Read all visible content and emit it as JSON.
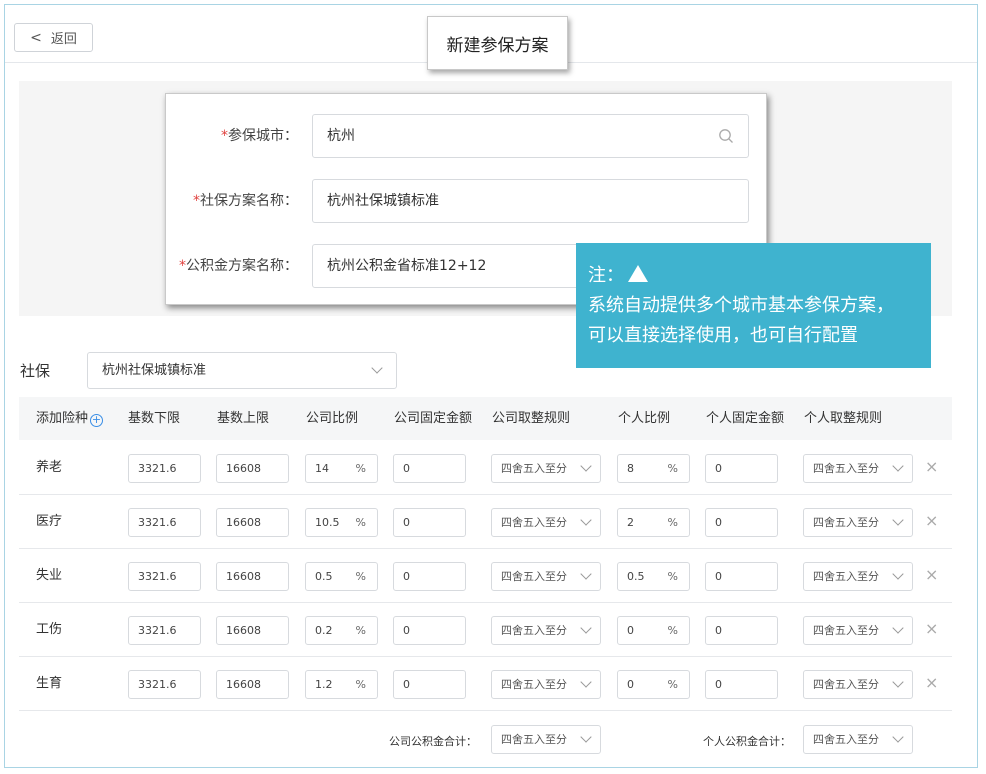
{
  "header": {
    "back_label": "返回",
    "title": "新建参保方案"
  },
  "form": {
    "city": {
      "label": "参保城市：",
      "value": "杭州",
      "required": "*"
    },
    "social_plan": {
      "label": "社保方案名称：",
      "value": "杭州社保城镇标准",
      "required": "*"
    },
    "fund_plan": {
      "label": "公积金方案名称：",
      "value": "杭州公积金省标准12+12",
      "required": "*"
    }
  },
  "note": {
    "line1": "注：",
    "line2": "系统自动提供多个城市基本参保方案，",
    "line3": "可以直接选择使用，也可自行配置"
  },
  "social": {
    "label": "社保",
    "selected": "杭州社保城镇标准"
  },
  "table": {
    "headers": [
      "添加险种",
      "基数下限",
      "基数上限",
      "公司比例",
      "公司固定金额",
      "公司取整规则",
      "个人比例",
      "个人固定金额",
      "个人取整规则"
    ],
    "percent_unit": "%",
    "rows": [
      {
        "name": "养老",
        "base_min": "3321.6",
        "base_max": "16608",
        "company_ratio": "14",
        "company_fixed": "0",
        "company_round": "四舍五入至分",
        "personal_ratio": "8",
        "personal_fixed": "0",
        "personal_round": "四舍五入至分"
      },
      {
        "name": "医疗",
        "base_min": "3321.6",
        "base_max": "16608",
        "company_ratio": "10.5",
        "company_fixed": "0",
        "company_round": "四舍五入至分",
        "personal_ratio": "2",
        "personal_fixed": "0",
        "personal_round": "四舍五入至分"
      },
      {
        "name": "失业",
        "base_min": "3321.6",
        "base_max": "16608",
        "company_ratio": "0.5",
        "company_fixed": "0",
        "company_round": "四舍五入至分",
        "personal_ratio": "0.5",
        "personal_fixed": "0",
        "personal_round": "四舍五入至分"
      },
      {
        "name": "工伤",
        "base_min": "3321.6",
        "base_max": "16608",
        "company_ratio": "0.2",
        "company_fixed": "0",
        "company_round": "四舍五入至分",
        "personal_ratio": "0",
        "personal_fixed": "0",
        "personal_round": "四舍五入至分"
      },
      {
        "name": "生育",
        "base_min": "3321.6",
        "base_max": "16608",
        "company_ratio": "1.2",
        "company_fixed": "0",
        "company_round": "四舍五入至分",
        "personal_ratio": "0",
        "personal_fixed": "0",
        "personal_round": "四舍五入至分"
      }
    ]
  },
  "footer": {
    "company_total_label": "公司公积金合计：",
    "company_total_round": "四舍五入至分",
    "personal_total_label": "个人公积金合计：",
    "personal_total_round": "四舍五入至分"
  },
  "icons": {
    "back": "chevron-left-icon",
    "search": "search-icon",
    "add": "plus-circle-icon",
    "dropdown": "chevron-down-icon",
    "delete": "close-icon",
    "note_arrow": "triangle-up-icon"
  },
  "colors": {
    "accent": "#3a8ee6",
    "note_bg": "#3fb3cf",
    "required": "#e0413e"
  }
}
